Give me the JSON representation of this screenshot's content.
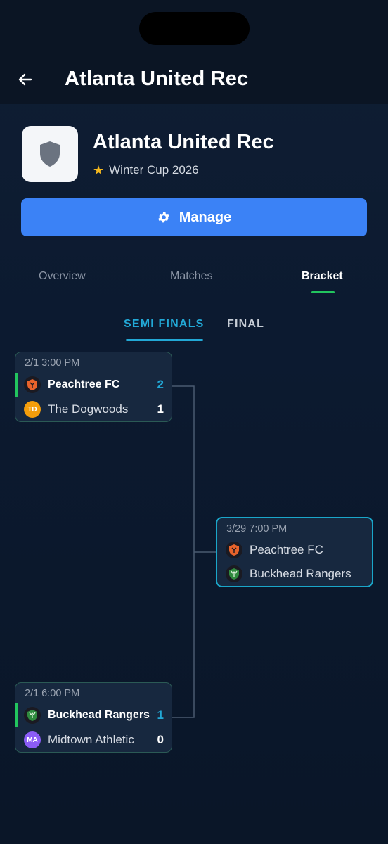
{
  "header": {
    "title": "Atlanta United Rec"
  },
  "team": {
    "name": "Atlanta United Rec",
    "competition": "Winter Cup 2026"
  },
  "manage_label": "Manage",
  "tabs": [
    {
      "label": "Overview",
      "active": false
    },
    {
      "label": "Matches",
      "active": false
    },
    {
      "label": "Bracket",
      "active": true
    }
  ],
  "rounds": [
    {
      "label": "SEMI FINALS",
      "active": true
    },
    {
      "label": "FINAL",
      "active": false
    }
  ],
  "matches": [
    {
      "time": "2/1 3:00 PM",
      "home": {
        "name": "Peachtree FC",
        "score": "2",
        "icon": "peachtree-crest-icon",
        "winner": true
      },
      "away": {
        "name": "The Dogwoods",
        "score": "1",
        "initials": "TD",
        "color": "#f59e0b"
      }
    },
    {
      "time": "2/1 6:00 PM",
      "home": {
        "name": "Buckhead Rangers",
        "score": "1",
        "icon": "buckhead-crest-icon",
        "winner": true
      },
      "away": {
        "name": "Midtown Athletic",
        "score": "0",
        "initials": "MA",
        "color": "#8b5cf6"
      }
    },
    {
      "time": "3/29 7:00 PM",
      "home": {
        "name": "Peachtree FC",
        "icon": "peachtree-crest-icon"
      },
      "away": {
        "name": "Buckhead Rangers",
        "icon": "buckhead-crest-icon"
      }
    }
  ],
  "colors": {
    "accent": "#3b82f6",
    "winner": "#22c55e",
    "round_active": "#22a8d6",
    "star": "#f5b81e"
  }
}
